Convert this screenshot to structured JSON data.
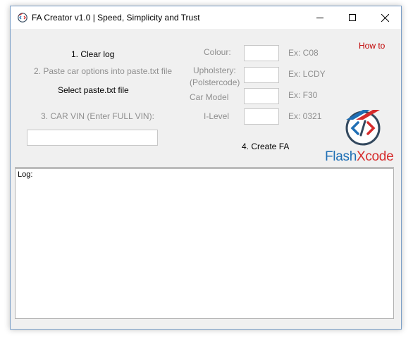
{
  "window": {
    "title": "FA Creator v1.0 | Speed, Simplicity and Trust"
  },
  "left": {
    "clear_log": "1. Clear log",
    "paste_step": "2. Paste car options into paste.txt file",
    "select_file": "Select paste.txt file",
    "vin_label": "3. CAR VIN (Enter FULL VIN):",
    "vin_value": ""
  },
  "fields": {
    "colour": {
      "label": "Colour:",
      "example": "Ex: C08",
      "value": ""
    },
    "upholstery": {
      "label_line1": "Upholstery:",
      "label_line2": "(Polstercode)",
      "example": "Ex: LCDY",
      "value": ""
    },
    "car_model": {
      "label": "Car Model",
      "example": "Ex: F30",
      "value": ""
    },
    "ilevel": {
      "label": "I-Level",
      "example": "Ex: 0321",
      "value": ""
    }
  },
  "create_fa": "4. Create FA",
  "howto": "How to",
  "logo": {
    "part1": "Flash",
    "part2": "X",
    "part3": "code"
  },
  "log": {
    "label": "Log:",
    "content": ""
  },
  "colors": {
    "link": "#c00000",
    "logo_blue": "#1f6fb5",
    "logo_red": "#d62b2b",
    "logo_dark": "#34495e"
  }
}
